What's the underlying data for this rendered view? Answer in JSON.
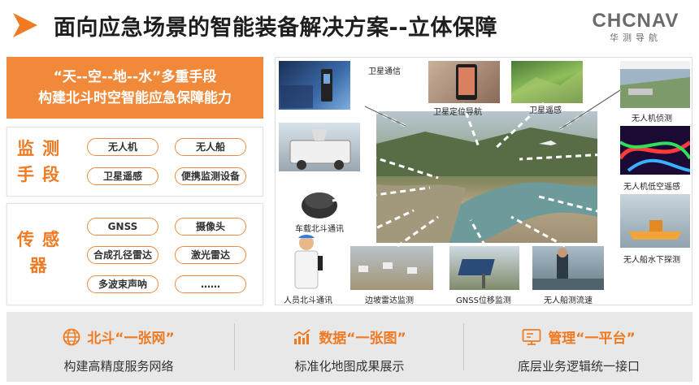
{
  "header": {
    "title": "面向应急场景的智能装备解决方案--立体保障",
    "brand_name": "CHCNAV",
    "brand_sub": "华测导航"
  },
  "banner": {
    "line1": "“天--空--地--水”多重手段",
    "line2": "构建北斗时空智能应急保障能力"
  },
  "monitoring": {
    "label_line1": "监测",
    "label_line2": "手段",
    "items": [
      "无人机",
      "无人船",
      "卫星遥感",
      "便携监测设备"
    ]
  },
  "sensors": {
    "label_line1": "传感",
    "label_line2": "器",
    "items": [
      "GNSS",
      "摄像头",
      "合成孔径雷达",
      "激光雷达",
      "多波束声呐",
      "……"
    ]
  },
  "montage": {
    "captions": {
      "sat_comm": "卫星通信",
      "sat_nav": "卫星定位导航",
      "sat_rs": "卫星遥感",
      "uav_detect": "无人机侦测",
      "uav_lowalt": "无人机低空遥感",
      "vehicle": "车载北斗通讯",
      "usv": "无人船水下探测",
      "person": "人员北斗通讯",
      "slope_radar": "边坡雷达监测",
      "gnss_disp": "GNSS位移监测",
      "boat_flow": "无人船测流速"
    }
  },
  "bottom": [
    {
      "icon": "globe-icon",
      "title": "北斗“一张网”",
      "subtitle": "构建高精度服务网络"
    },
    {
      "icon": "bar-chart-icon",
      "title": "数据“一张图”",
      "subtitle": "标准化地图成果展示"
    },
    {
      "icon": "monitor-icon",
      "title": "管理“一平台”",
      "subtitle": "底层业务逻辑统一接口"
    }
  ],
  "colors": {
    "accent": "#f08a3a",
    "accent_text": "#f07a22",
    "brand_gray": "#6b6b6b"
  }
}
